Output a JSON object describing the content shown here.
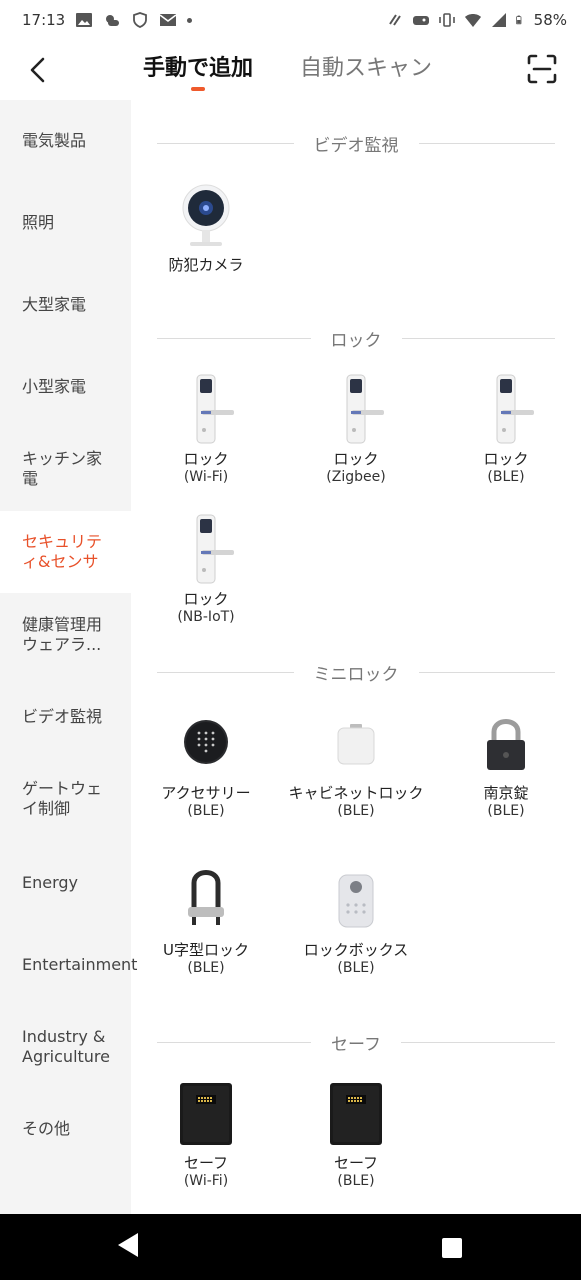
{
  "status": {
    "time": "17:13",
    "battery": "58%"
  },
  "header": {
    "tabs": [
      {
        "label": "手動で追加"
      },
      {
        "label": "自動スキャン"
      }
    ]
  },
  "sidebar": {
    "items": [
      {
        "label": "電気製品"
      },
      {
        "label": "照明"
      },
      {
        "label": "大型家電"
      },
      {
        "label": "小型家電"
      },
      {
        "label": "キッチン家電"
      },
      {
        "label": "セキュリティ&センサ"
      },
      {
        "label": "健康管理用ウェアラ..."
      },
      {
        "label": "ビデオ監視"
      },
      {
        "label": "ゲートウェイ制御"
      },
      {
        "label": "Energy"
      },
      {
        "label": "Entertainment"
      },
      {
        "label": "Industry & Agriculture"
      },
      {
        "label": "その他"
      }
    ]
  },
  "sections": {
    "video": {
      "title": "ビデオ監視",
      "devices": [
        {
          "name": "防犯カメラ"
        }
      ]
    },
    "lock": {
      "title": "ロック",
      "devices": [
        {
          "name": "ロック",
          "sub": "(Wi-Fi)"
        },
        {
          "name": "ロック",
          "sub": "(Zigbee)"
        },
        {
          "name": "ロック",
          "sub": "(BLE)"
        },
        {
          "name": "ロック",
          "sub": "(NB-IoT)"
        }
      ]
    },
    "minilock": {
      "title": "ミニロック",
      "devices": [
        {
          "name": "アクセサリー",
          "sub": "(BLE)"
        },
        {
          "name": "キャビネットロック",
          "sub": "(BLE)"
        },
        {
          "name": "南京錠",
          "sub": "(BLE)"
        },
        {
          "name": "U字型ロック",
          "sub": "(BLE)"
        },
        {
          "name": "ロックボックス",
          "sub": "(BLE)"
        }
      ]
    },
    "safe": {
      "title": "セーフ",
      "devices": [
        {
          "name": "セーフ",
          "sub": "(Wi-Fi)"
        },
        {
          "name": "セーフ",
          "sub": "(BLE)"
        }
      ]
    }
  },
  "colors": {
    "accent": "#e8512a",
    "sidebar_bg": "#f4f4f4"
  }
}
